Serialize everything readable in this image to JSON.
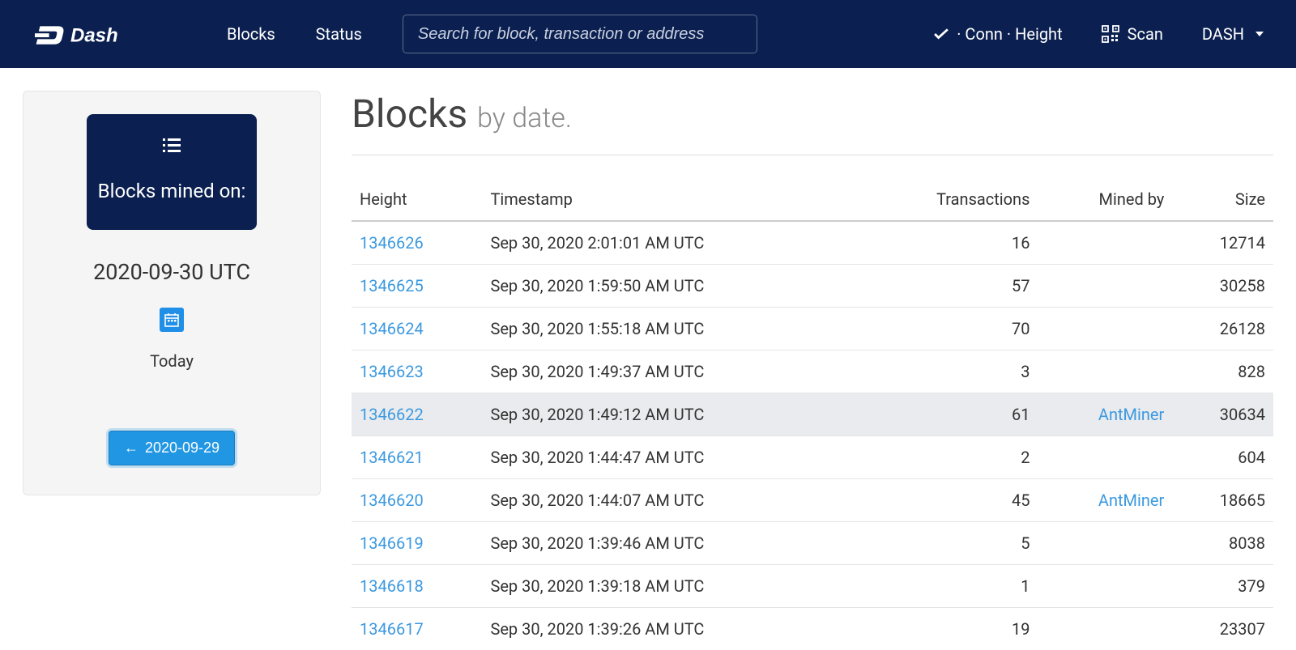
{
  "nav": {
    "blocks": "Blocks",
    "status": "Status",
    "search_placeholder": "Search for block, transaction or address",
    "conn_height": "· Conn · Height",
    "scan": "Scan",
    "currency": "DASH"
  },
  "sidebar": {
    "card_title": "Blocks mined on:",
    "date": "2020-09-30 UTC",
    "today": "Today",
    "prev_date": "2020-09-29"
  },
  "page": {
    "title": "Blocks",
    "subtitle": "by date."
  },
  "table": {
    "headers": {
      "height": "Height",
      "timestamp": "Timestamp",
      "transactions": "Transactions",
      "mined_by": "Mined by",
      "size": "Size"
    },
    "rows": [
      {
        "height": "1346626",
        "timestamp": "Sep 30, 2020 2:01:01 AM UTC",
        "transactions": "16",
        "mined_by": "",
        "size": "12714"
      },
      {
        "height": "1346625",
        "timestamp": "Sep 30, 2020 1:59:50 AM UTC",
        "transactions": "57",
        "mined_by": "",
        "size": "30258"
      },
      {
        "height": "1346624",
        "timestamp": "Sep 30, 2020 1:55:18 AM UTC",
        "transactions": "70",
        "mined_by": "",
        "size": "26128"
      },
      {
        "height": "1346623",
        "timestamp": "Sep 30, 2020 1:49:37 AM UTC",
        "transactions": "3",
        "mined_by": "",
        "size": "828"
      },
      {
        "height": "1346622",
        "timestamp": "Sep 30, 2020 1:49:12 AM UTC",
        "transactions": "61",
        "mined_by": "AntMiner",
        "size": "30634",
        "hover": true
      },
      {
        "height": "1346621",
        "timestamp": "Sep 30, 2020 1:44:47 AM UTC",
        "transactions": "2",
        "mined_by": "",
        "size": "604"
      },
      {
        "height": "1346620",
        "timestamp": "Sep 30, 2020 1:44:07 AM UTC",
        "transactions": "45",
        "mined_by": "AntMiner",
        "size": "18665"
      },
      {
        "height": "1346619",
        "timestamp": "Sep 30, 2020 1:39:46 AM UTC",
        "transactions": "5",
        "mined_by": "",
        "size": "8038"
      },
      {
        "height": "1346618",
        "timestamp": "Sep 30, 2020 1:39:18 AM UTC",
        "transactions": "1",
        "mined_by": "",
        "size": "379"
      },
      {
        "height": "1346617",
        "timestamp": "Sep 30, 2020 1:39:26 AM UTC",
        "transactions": "19",
        "mined_by": "",
        "size": "23307"
      }
    ]
  }
}
